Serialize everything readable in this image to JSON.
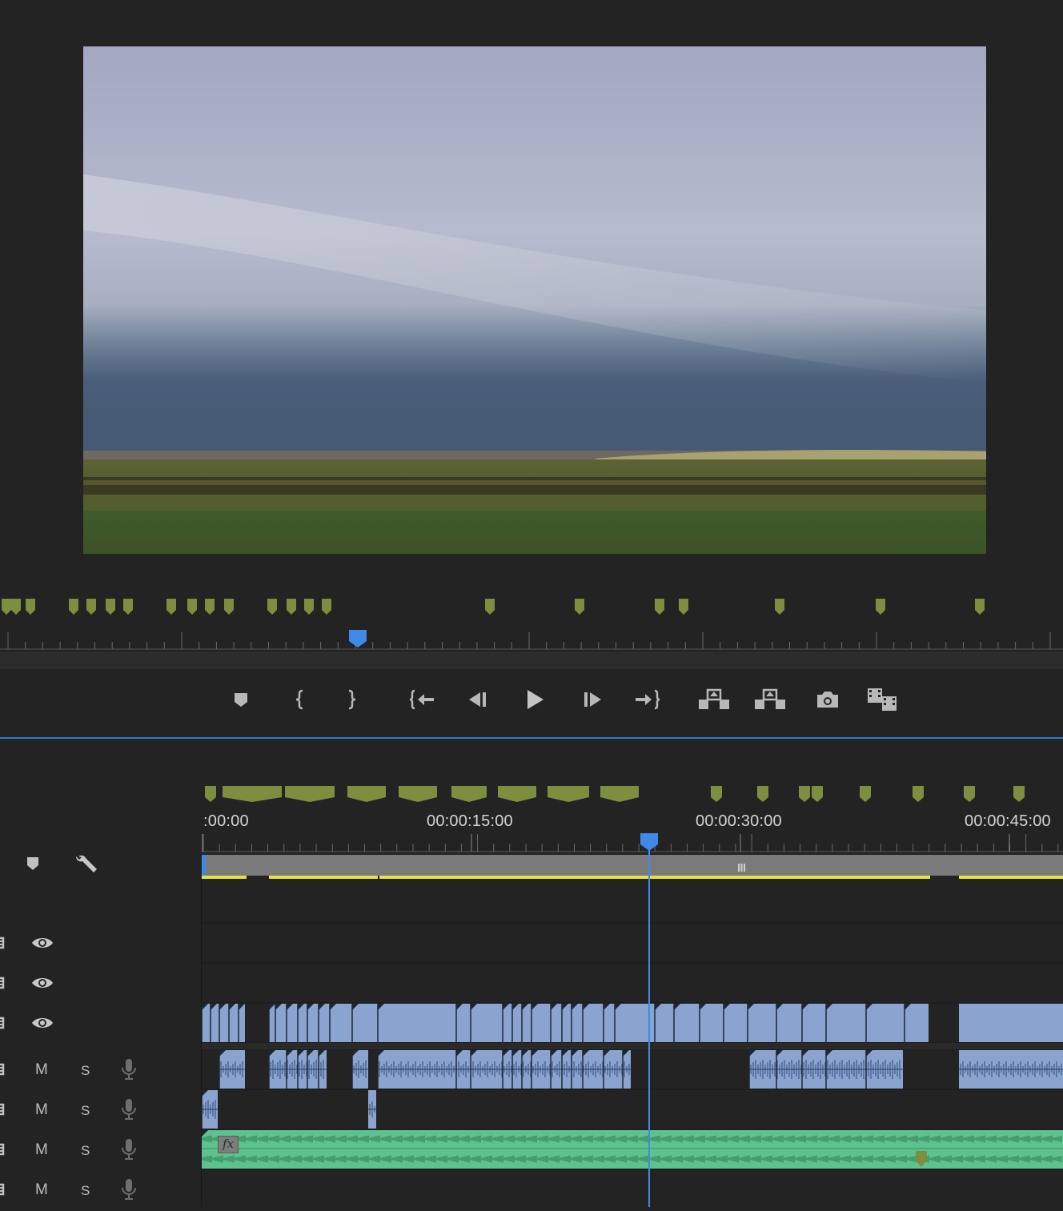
{
  "timeline": {
    "timecodes": [
      ":00:00",
      "00:00:15:00",
      "00:00:30:00",
      "00:00:45:00"
    ]
  },
  "icons": {
    "monitor_transport": [
      "add-marker-icon",
      "mark-in-icon",
      "mark-out-icon",
      "go-to-in-icon",
      "step-back-icon",
      "play-icon",
      "step-forward-icon",
      "go-to-out-icon",
      "lift-icon",
      "extract-icon",
      "export-frame-icon",
      "button-editor-icon"
    ],
    "timeline_header": [
      "add-marker-icon",
      "wrench-icon"
    ],
    "video_track_controls": [
      "toggle-output-eye-icon"
    ],
    "audio_track_controls": [
      "mute-label",
      "solo-label",
      "voice-over-mic-icon"
    ]
  },
  "audio_tracks": [
    {
      "mute": "M",
      "solo": "S"
    },
    {
      "mute": "M",
      "solo": "S"
    },
    {
      "mute": "M",
      "solo": "S"
    },
    {
      "mute": "M",
      "solo": "S"
    }
  ],
  "clip_badges": {
    "fx": "fx"
  },
  "colors": {
    "panel_bg": "#232323",
    "marker_green": "#7d8f3e",
    "playhead_blue": "#3e8ae6",
    "video_clip": "#8aa3cf",
    "audio_clip": "#8aa3cf",
    "music_clip": "#5ec28e",
    "render_bar_yellow": "#e9e23c"
  }
}
